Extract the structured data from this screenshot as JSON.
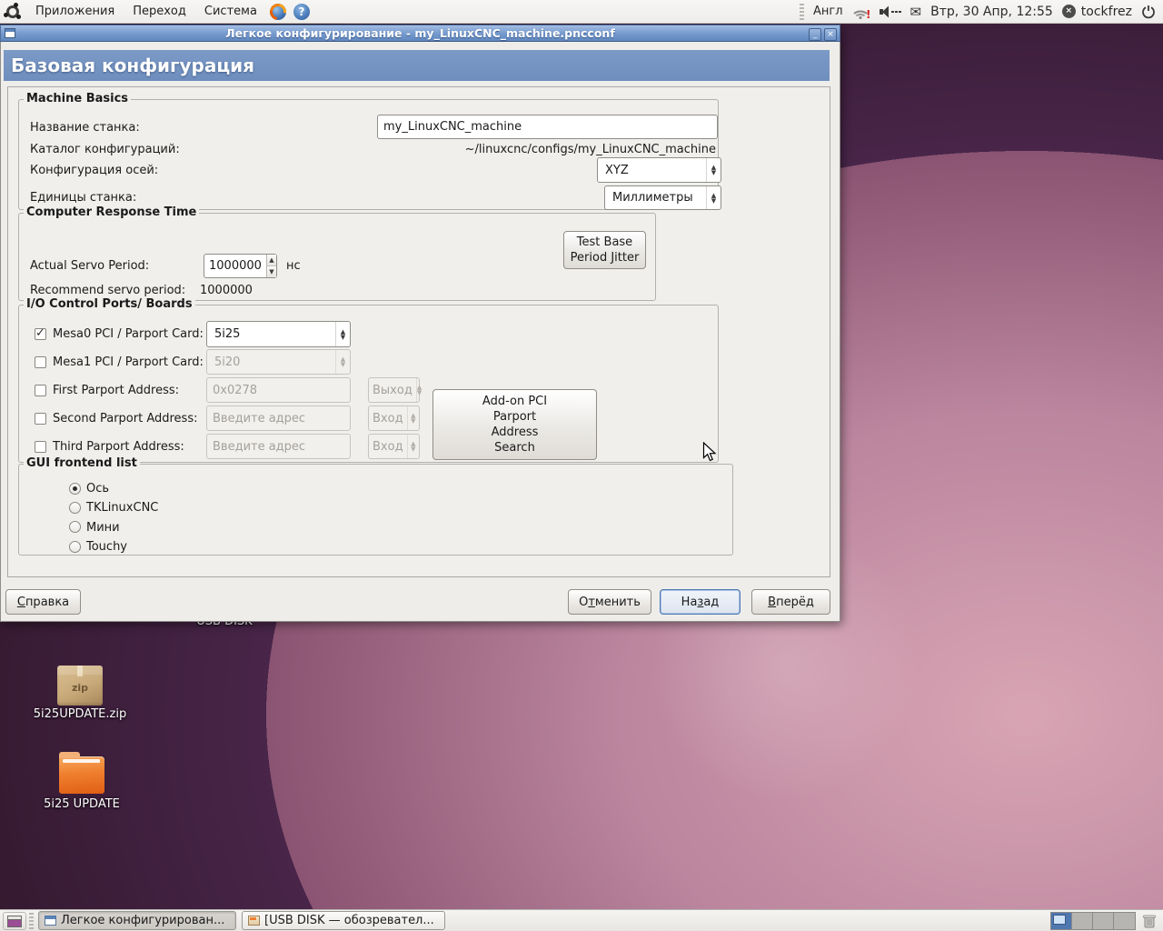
{
  "top_panel": {
    "menus": [
      {
        "label": "Приложения"
      },
      {
        "label": "Переход"
      },
      {
        "label": "Система"
      }
    ],
    "keyboard_layout": "Англ",
    "clock": "Втр, 30 Апр, 12:55",
    "username": "tockfrez",
    "status_glyph": "×",
    "help_glyph": "?",
    "mail_glyph": "✉"
  },
  "window": {
    "title": "Легкое конфигурирование - my_LinuxCNC_machine.pncconf",
    "minimize_glyph": "_",
    "close_glyph": "×",
    "page_title": "Базовая конфигурация",
    "machine_basics": {
      "legend": "Machine Basics",
      "name_label": "Название станка:",
      "name_value": "my_LinuxCNC_machine",
      "dir_label": "Каталог конфигураций:",
      "dir_value": "~/linuxcnc/configs/my_LinuxCNC_machine",
      "axes_label": "Конфигурация осей:",
      "axes_value": "XYZ",
      "units_label": "Единицы станка:",
      "units_value": "Миллиметры"
    },
    "response": {
      "legend": "Computer Response Time",
      "servo_label": "Actual Servo Period:",
      "servo_value": "1000000",
      "servo_units": "нс",
      "recommend_label": "Recommend servo period:",
      "recommend_value": "1000000",
      "test_button_lines": [
        "Test Base",
        "Period Jitter"
      ]
    },
    "io": {
      "legend": "I/O Control Ports/ Boards",
      "mesa0_label": "Mesa0 PCI / Parport Card:",
      "mesa0_value": "5i25",
      "mesa1_label": "Mesa1 PCI / Parport Card:",
      "mesa1_value": "5i20",
      "pp1_label": "First Parport Address:",
      "pp1_value": "0x0278",
      "pp1_dir": "Выход",
      "pp2_label": "Second Parport Address:",
      "pp2_value": "Введите адрес",
      "pp2_dir": "Вход",
      "pp3_label": "Third Parport Address:",
      "pp3_value": "Введите адрес",
      "pp3_dir": "Вход",
      "addon_button_lines": [
        "Add-on PCI",
        "Parport",
        "Address",
        "Search"
      ]
    },
    "gui": {
      "legend": "GUI frontend list",
      "options": [
        {
          "label": "Ось",
          "selected": true
        },
        {
          "label": "TKLinuxCNC",
          "selected": false
        },
        {
          "label": "Мини",
          "selected": false
        },
        {
          "label": "Touchy",
          "selected": false
        }
      ]
    },
    "actions": {
      "help": {
        "label": "Справка",
        "mnemonic": 0
      },
      "cancel": {
        "label": "Отменить",
        "mnemonic": 1
      },
      "back": {
        "label": "Назад",
        "mnemonic": 2
      },
      "forward": {
        "label": "Вперёд",
        "mnemonic": 0
      }
    }
  },
  "desktop": {
    "usb_icon_label": "USB DISK",
    "zip_icon_label": "5i25UPDATE.zip",
    "zip_badge": "zip",
    "folder_icon_label": "5i25 UPDATE"
  },
  "taskbar": {
    "tasks": [
      {
        "label": "Легкое конфигурирован..."
      },
      {
        "label": "[USB DISK — обозревател..."
      }
    ]
  },
  "colors": {
    "titlebar_blue": "#7499cd",
    "header_band_blue": "#7492c2",
    "desktop_dark": "#2a1322",
    "desktop_pink": "#c795aa",
    "focus_blue": "#4d7ab5"
  }
}
